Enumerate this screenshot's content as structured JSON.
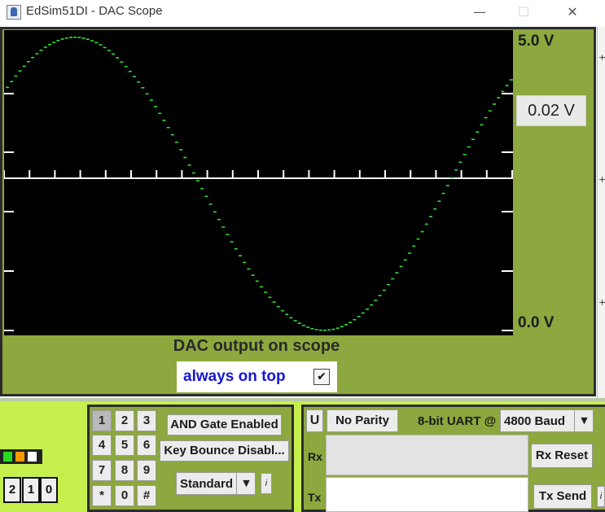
{
  "window": {
    "title": "EdSim51DI - DAC Scope",
    "icon": "java-app-icon",
    "controls": {
      "minimize": "—",
      "maximize": "☐",
      "close": "✕"
    }
  },
  "scope": {
    "v_max_label": "5.0 V",
    "v_min_label": "0.0 V",
    "volts_per_div": "0.02 V",
    "caption": "DAC output on scope",
    "always_on_top_label": "always on top",
    "always_on_top_checked": true,
    "check_glyph": "✔",
    "trace_color": "#33dd33",
    "background_color": "#000000",
    "panel_color": "#8ca83e"
  },
  "right_strip": {
    "glyph": "+"
  },
  "leds": [
    "#27d91f",
    "#ff9900",
    "#ffffff"
  ],
  "digits": [
    "2",
    "1",
    "0"
  ],
  "keypad": {
    "keys": [
      "1",
      "2",
      "3",
      "4",
      "5",
      "6",
      "7",
      "8",
      "9",
      "*",
      "0",
      "#"
    ],
    "pressed_key": "1",
    "and_gate_label": "AND Gate Enabled",
    "key_bounce_label": "Key Bounce Disabl...",
    "mode_value": "Standard",
    "dropdown_glyph": "▼",
    "info_label": "i"
  },
  "uart": {
    "u_label": "U",
    "parity_label": "No Parity",
    "uart_label": "8-bit UART @",
    "baud_value": "4800 Baud",
    "dropdown_glyph": "▼",
    "rx_label": "Rx",
    "tx_label": "Tx",
    "rx_reset_label": "Rx Reset",
    "tx_send_label": "Tx Send",
    "info_label": "i"
  },
  "colors": {
    "bottom_background": "#c6ef4e",
    "panel_green": "#8ca83e",
    "title_blue": "#1616d6"
  }
}
